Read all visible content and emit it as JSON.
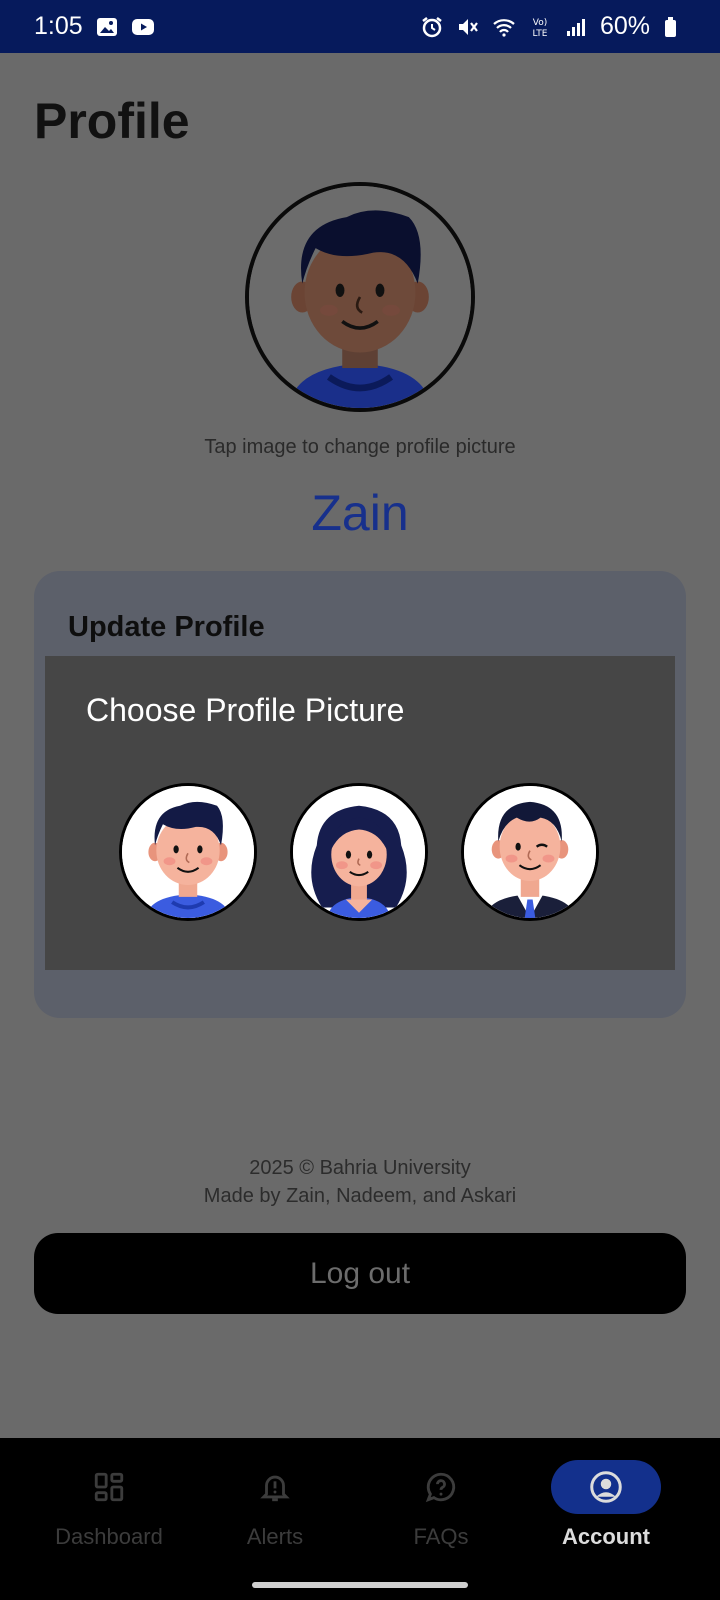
{
  "status_bar": {
    "time": "1:05",
    "battery": "60%",
    "network": "LTE"
  },
  "page": {
    "title": "Profile",
    "avatar_hint": "Tap image to change profile picture",
    "user_name": "Zain"
  },
  "update_card": {
    "title": "Update Profile"
  },
  "modal": {
    "title": "Choose Profile Picture",
    "options": [
      {
        "name": "boy-avatar"
      },
      {
        "name": "girl-avatar"
      },
      {
        "name": "businessman-avatar"
      }
    ]
  },
  "footer": {
    "copyright": "2025 © Bahria University",
    "made_by": "Made by Zain, Nadeem, and Askari"
  },
  "logout_label": "Log out",
  "bottom_nav": {
    "items": [
      {
        "label": "Dashboard",
        "icon": "dashboard-icon"
      },
      {
        "label": "Alerts",
        "icon": "bell-icon"
      },
      {
        "label": "FAQs",
        "icon": "question-icon"
      },
      {
        "label": "Account",
        "icon": "account-icon",
        "active": true
      }
    ]
  },
  "colors": {
    "status_bar": "#061a5c",
    "accent": "#13308c",
    "name_text": "#17308c",
    "overlay_bg": "#6a6a6a",
    "modal_bg": "#464646"
  }
}
